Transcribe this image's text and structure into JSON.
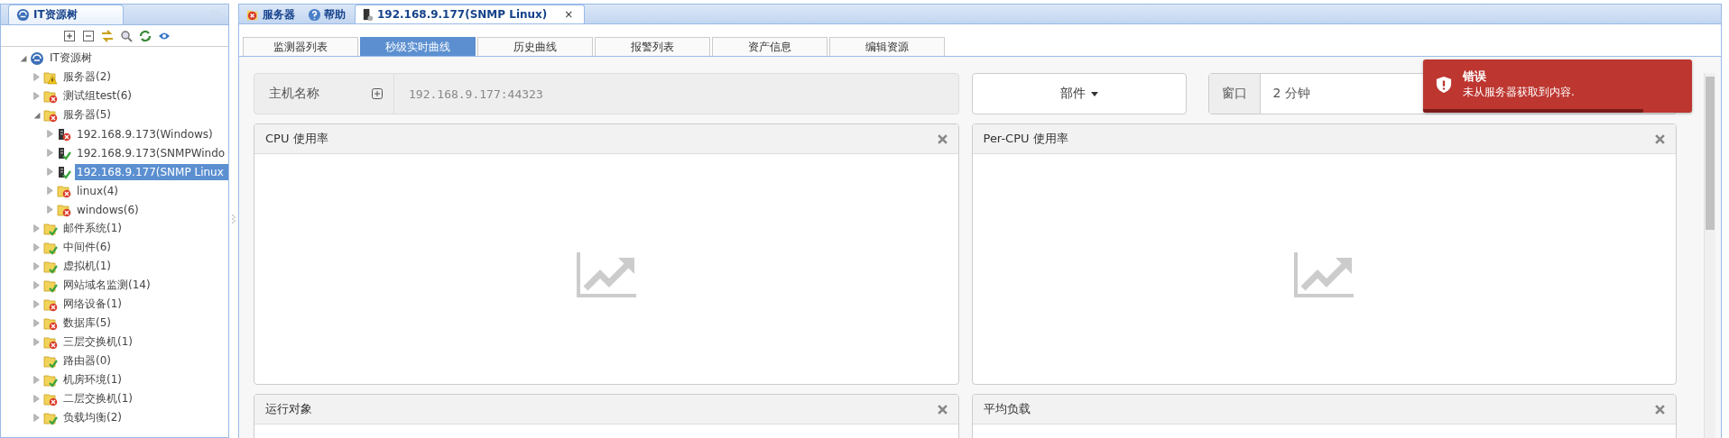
{
  "tree_panel": {
    "title": "IT资源树",
    "tree": {
      "label": "IT资源树",
      "kind": "root",
      "expandable": true,
      "expanded": true,
      "selected": false,
      "children": [
        {
          "label": "服务器(2)",
          "kind": "folder",
          "error": false,
          "warning": true,
          "expandable": true,
          "expanded": false,
          "selected": false
        },
        {
          "label": "测试组test(6)",
          "kind": "folder",
          "error": true,
          "warning": false,
          "expandable": true,
          "expanded": false,
          "selected": false
        },
        {
          "label": "服务器(5)",
          "kind": "folder",
          "error": true,
          "warning": false,
          "expandable": true,
          "expanded": true,
          "selected": false,
          "children": [
            {
              "label": "192.168.9.173(Windows)",
              "kind": "host",
              "error": true,
              "warning": false,
              "expandable": true,
              "expanded": false,
              "selected": false
            },
            {
              "label": "192.168.9.173(SNMPWindo",
              "kind": "host",
              "error": false,
              "warning": false,
              "expandable": true,
              "expanded": false,
              "selected": false
            },
            {
              "label": "192.168.9.177(SNMP Linux",
              "kind": "host",
              "error": false,
              "warning": false,
              "expandable": true,
              "expanded": false,
              "selected": true
            },
            {
              "label": "linux(4)",
              "kind": "folder",
              "error": true,
              "warning": false,
              "expandable": true,
              "expanded": false,
              "selected": false
            },
            {
              "label": "windows(6)",
              "kind": "folder",
              "error": true,
              "warning": false,
              "expandable": true,
              "expanded": false,
              "selected": false
            }
          ]
        },
        {
          "label": "邮件系统(1)",
          "kind": "folder",
          "error": false,
          "warning": false,
          "expandable": true,
          "expanded": false,
          "selected": false
        },
        {
          "label": "中间件(6)",
          "kind": "folder",
          "error": false,
          "warning": false,
          "expandable": true,
          "expanded": false,
          "selected": false
        },
        {
          "label": "虚拟机(1)",
          "kind": "folder",
          "error": false,
          "warning": false,
          "expandable": true,
          "expanded": false,
          "selected": false
        },
        {
          "label": "网站域名监测(14)",
          "kind": "folder",
          "error": false,
          "warning": false,
          "expandable": true,
          "expanded": false,
          "selected": false
        },
        {
          "label": "网络设备(1)",
          "kind": "folder",
          "error": true,
          "warning": false,
          "expandable": true,
          "expanded": false,
          "selected": false
        },
        {
          "label": "数据库(5)",
          "kind": "folder",
          "error": true,
          "warning": false,
          "expandable": true,
          "expanded": false,
          "selected": false
        },
        {
          "label": "三层交换机(1)",
          "kind": "folder",
          "error": true,
          "warning": false,
          "expandable": true,
          "expanded": false,
          "selected": false
        },
        {
          "label": "路由器(0)",
          "kind": "folder",
          "error": false,
          "warning": false,
          "expandable": false,
          "selected": false
        },
        {
          "label": "机房环境(1)",
          "kind": "folder",
          "error": false,
          "warning": false,
          "expandable": true,
          "expanded": false,
          "selected": false
        },
        {
          "label": "二层交换机(1)",
          "kind": "folder",
          "error": true,
          "warning": false,
          "expandable": true,
          "expanded": false,
          "selected": false
        },
        {
          "label": "负载均衡(2)",
          "kind": "folder",
          "error": false,
          "warning": false,
          "expandable": true,
          "expanded": false,
          "selected": false
        }
      ]
    }
  },
  "main_tabs": [
    {
      "label": "服务器",
      "selected": false
    },
    {
      "label": "帮助",
      "selected": false
    },
    {
      "label": "192.168.9.177(SNMP Linux)",
      "selected": true,
      "close": "×"
    }
  ],
  "sub_tabs": [
    {
      "label": "监测器列表",
      "selected": false
    },
    {
      "label": "秒级实时曲线",
      "selected": true
    },
    {
      "label": "历史曲线",
      "selected": false
    },
    {
      "label": "报警列表",
      "selected": false
    },
    {
      "label": "资产信息",
      "selected": false
    },
    {
      "label": "编辑资源",
      "selected": false
    }
  ],
  "host_field": {
    "label": "主机名称",
    "value": "192.168.9.177:44323"
  },
  "component_dropdown": {
    "label": "部件"
  },
  "window_field": {
    "label": "窗口",
    "value": "2 分钟"
  },
  "cards": [
    {
      "title": "CPU 使用率",
      "empty": true
    },
    {
      "title": "Per-CPU 使用率",
      "empty": true
    },
    {
      "title": "运行对象",
      "empty": false
    },
    {
      "title": "平均负载",
      "empty": false
    }
  ],
  "toast": {
    "title": "错误",
    "message": "未从服务器获取到内容.",
    "level": 0.82
  }
}
